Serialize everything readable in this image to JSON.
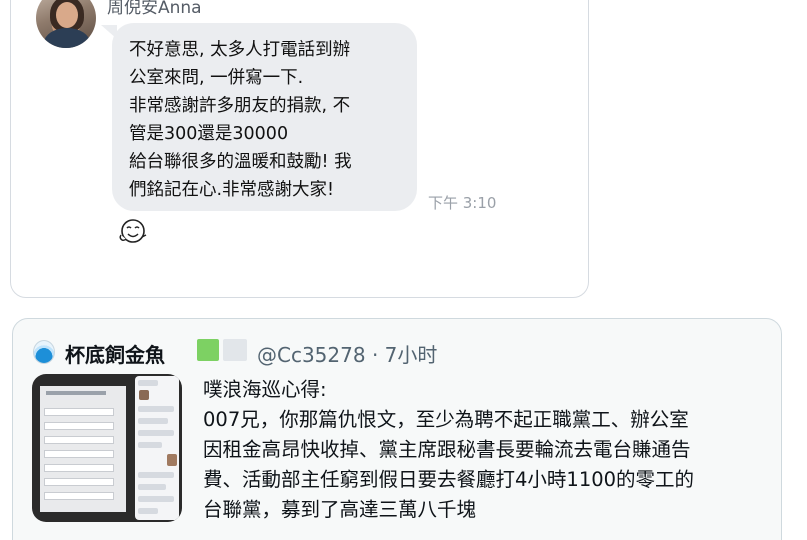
{
  "chat": {
    "sender_name": "周倪安Anna",
    "message_lines": [
      "不好意思, 太多人打電話到辦",
      "公室來問, 一併寫一下.",
      "非常感謝許多朋友的捐款, 不",
      "管是300還是30000",
      "給台聯很多的溫暖和鼓勵! 我",
      "們銘記在心.非常感謝大家!"
    ],
    "time": "下午 3:10",
    "reaction_icon": "smile-reaction-icon"
  },
  "quote": {
    "author_name": "杯底飼金魚",
    "handle_time": "@Cc35278 · 7小时",
    "text_lines": [
      "噗浪海巡心得:",
      "007兄，你那篇仇恨文，至少為聘不起正職黨工、辦公室",
      "因租金高昂快收掉、黨主席跟秘書長要輪流去電台賺通告",
      "費、活動部主任窮到假日要去餐廳打4小時1100的零工的",
      "台聯黨，募到了高達三萬八千塊"
    ],
    "avatar_icon": "fishbowl-icon",
    "badge_colors": [
      "#7dd163",
      "#e2e6ea"
    ]
  }
}
